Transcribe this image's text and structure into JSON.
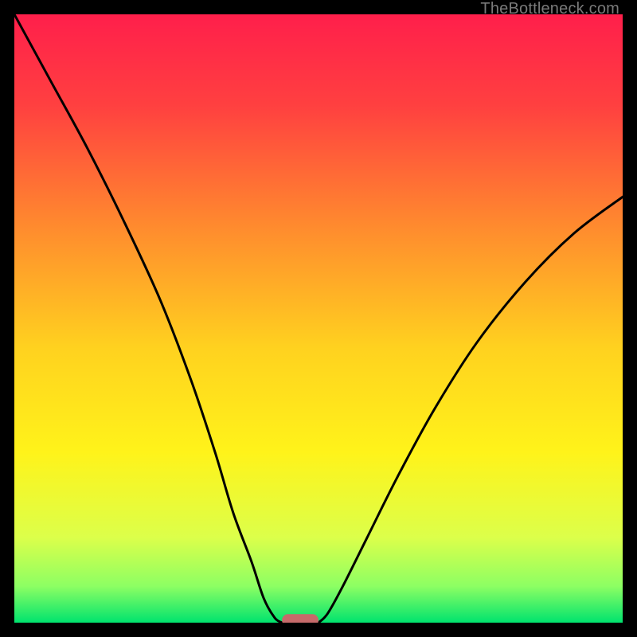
{
  "watermark": "TheBottleneck.com",
  "chart_data": {
    "type": "line",
    "title": "",
    "xlabel": "",
    "ylabel": "",
    "xlim": [
      0,
      100
    ],
    "ylim": [
      0,
      100
    ],
    "grid": false,
    "legend": false,
    "gradient_stops": [
      {
        "offset": 0.0,
        "color": "#ff1f4b"
      },
      {
        "offset": 0.15,
        "color": "#ff4040"
      },
      {
        "offset": 0.35,
        "color": "#ff8b2e"
      },
      {
        "offset": 0.55,
        "color": "#ffd21f"
      },
      {
        "offset": 0.72,
        "color": "#fff31a"
      },
      {
        "offset": 0.86,
        "color": "#dcff4a"
      },
      {
        "offset": 0.94,
        "color": "#8dff63"
      },
      {
        "offset": 1.0,
        "color": "#00e36e"
      }
    ],
    "series": [
      {
        "name": "left_curve",
        "x": [
          0,
          6,
          12,
          18,
          24,
          29,
          33,
          36,
          39,
          41,
          42.8,
          44.0
        ],
        "y": [
          100,
          89,
          78,
          66,
          53,
          40,
          28,
          18,
          10,
          4,
          0.8,
          0.0
        ]
      },
      {
        "name": "right_curve",
        "x": [
          50.0,
          51.5,
          54,
          58,
          63,
          69,
          76,
          84,
          92,
          100
        ],
        "y": [
          0.0,
          1.5,
          6,
          14,
          24,
          35,
          46,
          56,
          64,
          70
        ]
      }
    ],
    "marker": {
      "name": "min_marker",
      "x_start": 44.0,
      "x_end": 50.0,
      "y": 0.4,
      "color": "#c66a6a",
      "height_pct": 2.0,
      "rx_pct": 1
    }
  }
}
